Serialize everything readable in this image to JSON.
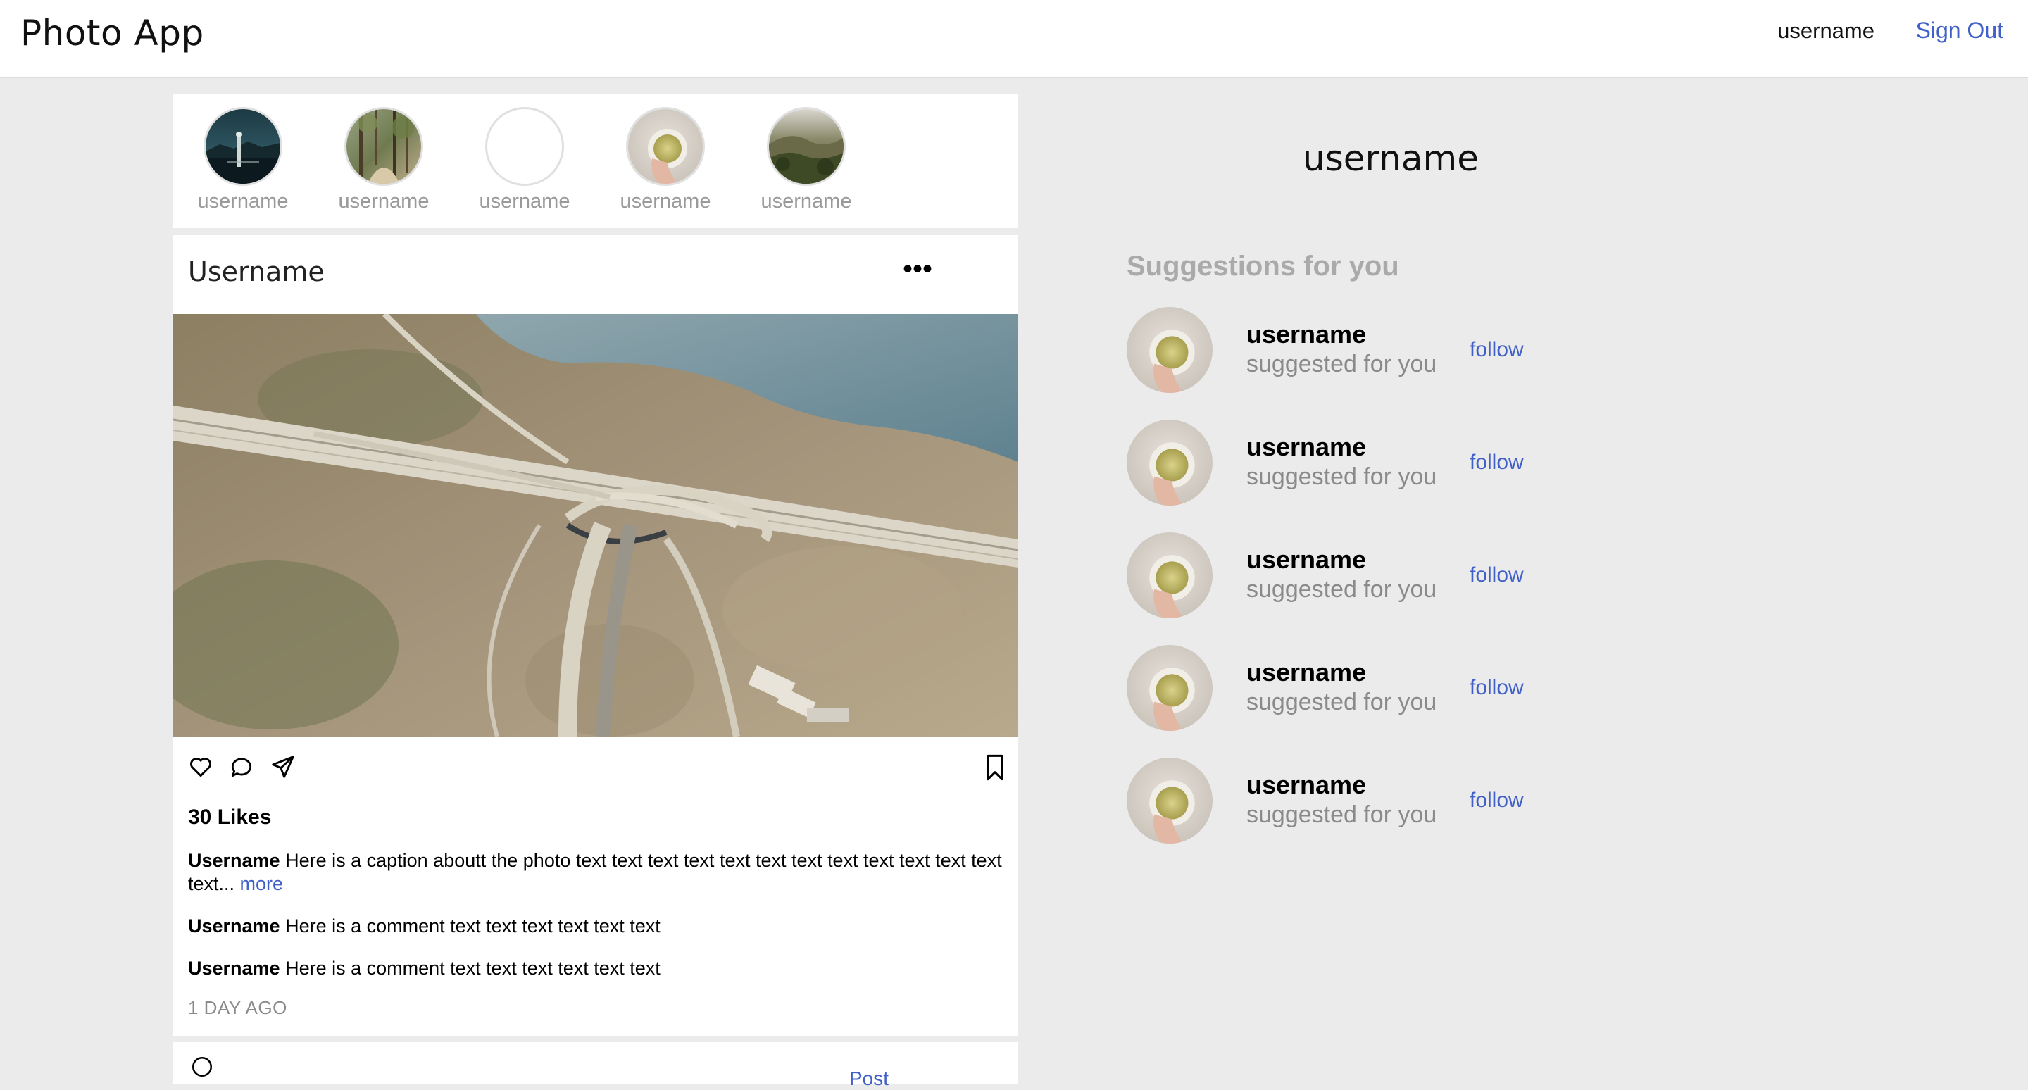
{
  "header": {
    "title": "Photo App",
    "username": "username",
    "sign_out": "Sign Out"
  },
  "stories": [
    {
      "name": "username",
      "avatar": "lake-photo"
    },
    {
      "name": "username",
      "avatar": "forest-photo"
    },
    {
      "name": "username",
      "avatar": "blank"
    },
    {
      "name": "username",
      "avatar": "tea-cup-photo"
    },
    {
      "name": "username",
      "avatar": "hills-photo"
    }
  ],
  "post": {
    "author": "Username",
    "menu_icon": "•••",
    "image": "aerial-highway-interchange",
    "likes": "30 Likes",
    "caption_user": "Username",
    "caption_text": " Here is a caption aboutt the photo text text text text text text text text text text text text text...",
    "caption_more": "more",
    "comments": [
      {
        "user": "Username",
        "text": " Here is a comment text text text text text text"
      },
      {
        "user": "Username",
        "text": " Here is a comment text text text text text text"
      }
    ],
    "time": "1 DAY AGO",
    "post_button": "Post"
  },
  "sidebar": {
    "profile_name": "username",
    "suggestions_title": "Suggestions for you",
    "suggestions": [
      {
        "user": "username",
        "sub": "suggested for you",
        "action": "follow"
      },
      {
        "user": "username",
        "sub": "suggested for you",
        "action": "follow"
      },
      {
        "user": "username",
        "sub": "suggested for you",
        "action": "follow"
      },
      {
        "user": "username",
        "sub": "suggested for you",
        "action": "follow"
      },
      {
        "user": "username",
        "sub": "suggested for you",
        "action": "follow"
      }
    ]
  },
  "colors": {
    "background": "#ebebeb",
    "link": "#4060c8",
    "muted": "#8a8a8a"
  }
}
